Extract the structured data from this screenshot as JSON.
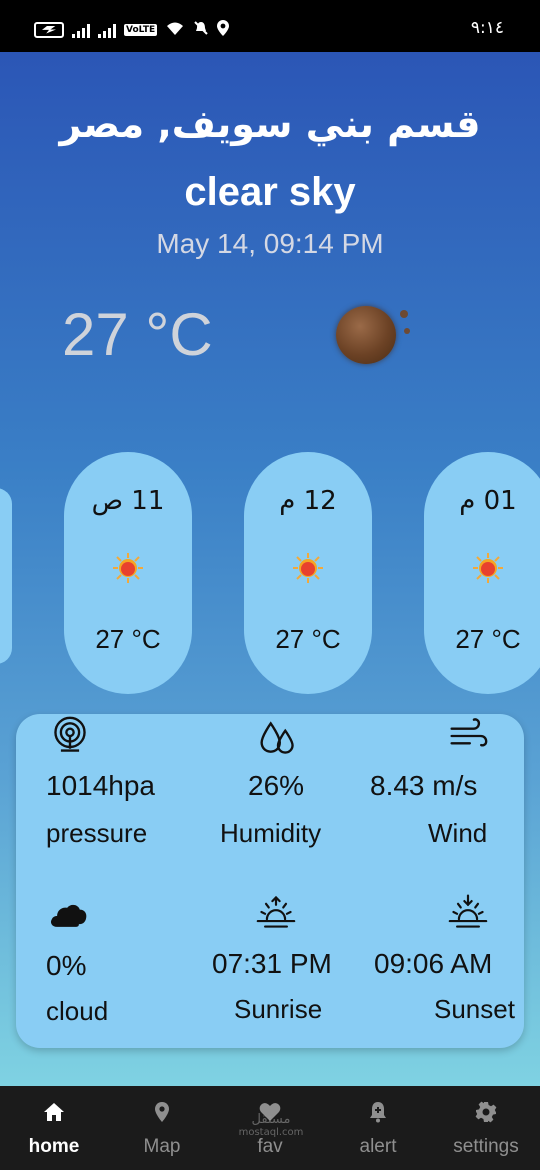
{
  "status_bar": {
    "time": "٩:١٤",
    "volte": "VoLTE"
  },
  "location": {
    "city": "قسم بني سويف, مصر"
  },
  "current": {
    "condition": "clear sky",
    "datetime": "May 14, 09:14 PM",
    "temperature": "27 °C",
    "icon": "moon-icon"
  },
  "hourly": [
    {
      "time": "11 ص",
      "temp": "27 °C",
      "icon": "sun-icon"
    },
    {
      "time": "12 م",
      "temp": "27 °C",
      "icon": "sun-icon"
    },
    {
      "time": "01 م",
      "temp": "27 °C",
      "icon": "sun-icon"
    }
  ],
  "details": {
    "pressure": {
      "value": "1014hpa",
      "label": "pressure",
      "icon": "pressure-icon"
    },
    "humidity": {
      "value": "26%",
      "label": "Humidity",
      "icon": "humidity-icon"
    },
    "wind": {
      "value": "8.43 m/s",
      "label": "Wind",
      "icon": "wind-icon"
    },
    "cloud": {
      "value": "0%",
      "label": "cloud",
      "icon": "cloud-icon"
    },
    "sunrise": {
      "value": "07:31 PM",
      "label": "Sunrise",
      "icon": "sunrise-icon"
    },
    "sunset": {
      "value": "09:06 AM",
      "label": "Sunset",
      "icon": "sunset-icon"
    }
  },
  "nav": {
    "items": [
      {
        "label": "home",
        "icon": "home-icon",
        "active": true
      },
      {
        "label": "Map",
        "icon": "map-pin-icon",
        "active": false
      },
      {
        "label": "fav",
        "icon": "heart-icon",
        "active": false
      },
      {
        "label": "alert",
        "icon": "bell-icon",
        "active": false
      },
      {
        "label": "settings",
        "icon": "gear-icon",
        "active": false
      }
    ]
  },
  "watermark": {
    "text": "مستقل",
    "sub": "mostaql.com"
  },
  "colors": {
    "gradient_top": "#2b56b6",
    "gradient_bottom": "#7fd2e2",
    "card": "#89cdf4",
    "nav_bg": "#1b1b1b",
    "nav_active": "#ffffff",
    "nav_inactive": "#8f8f8f"
  }
}
